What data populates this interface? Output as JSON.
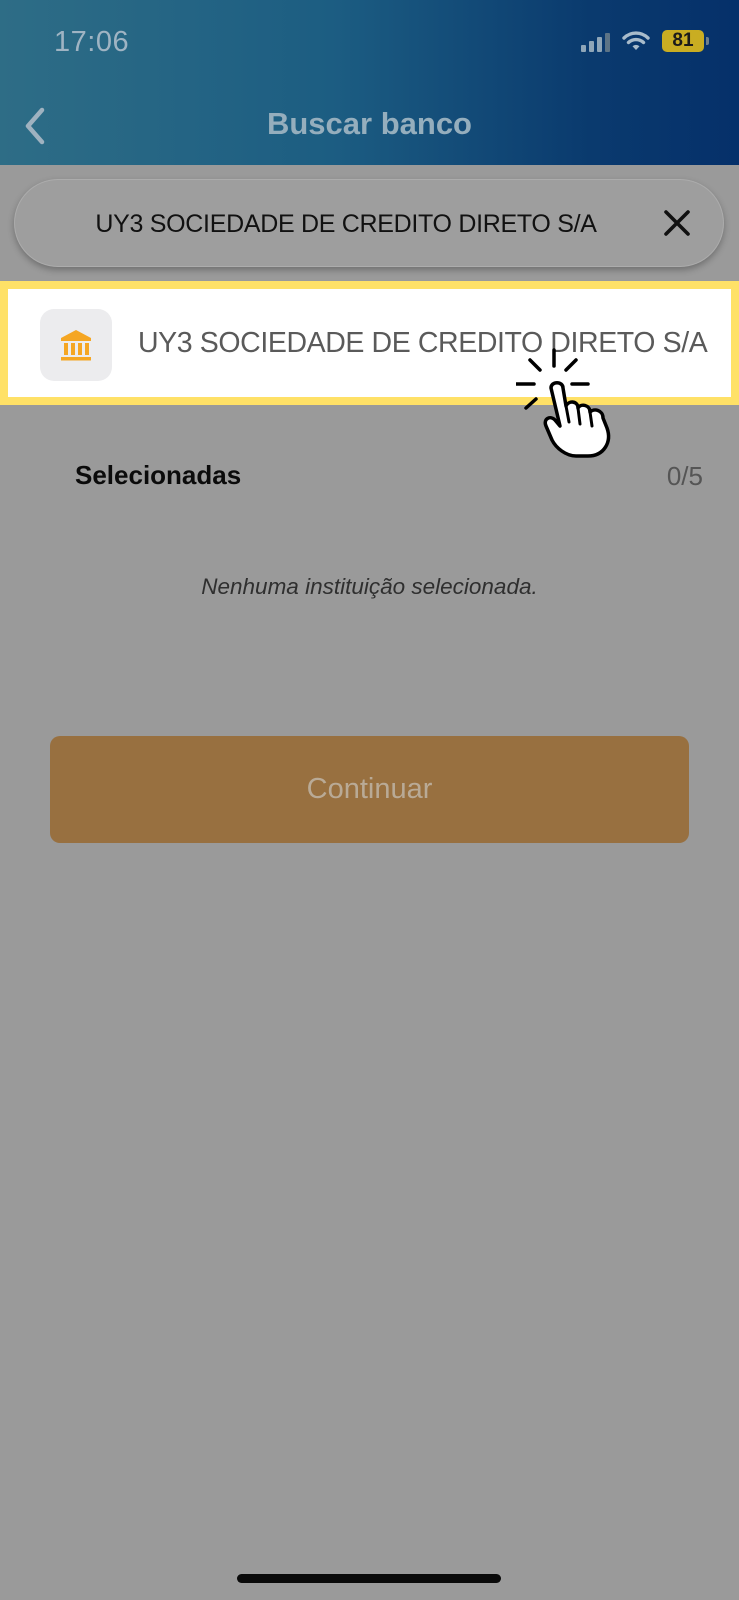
{
  "status_bar": {
    "time": "17:06",
    "battery": "81",
    "icons": [
      "cellular-signal-icon",
      "wifi-icon",
      "battery-icon"
    ]
  },
  "header": {
    "title": "Buscar banco",
    "back_icon": "chevron-left-icon"
  },
  "search": {
    "value": "UY3 SOCIEDADE DE CREDITO DIRETO S/A",
    "clear_icon": "close-icon"
  },
  "results": [
    {
      "label": "UY3 SOCIEDADE DE CREDITO DIRETO S/A",
      "icon": "bank-icon",
      "highlighted": true
    }
  ],
  "selected": {
    "title": "Selecionadas",
    "count": "0/5",
    "empty_message": "Nenhuma instituição selecionada."
  },
  "actions": {
    "continue_label": "Continuar"
  },
  "colors": {
    "header_gradient_start": "#2e6d86",
    "header_gradient_end": "#05306a",
    "highlight": "#ffe167",
    "bank_icon": "#f5a623",
    "continue_button": "#987040"
  }
}
